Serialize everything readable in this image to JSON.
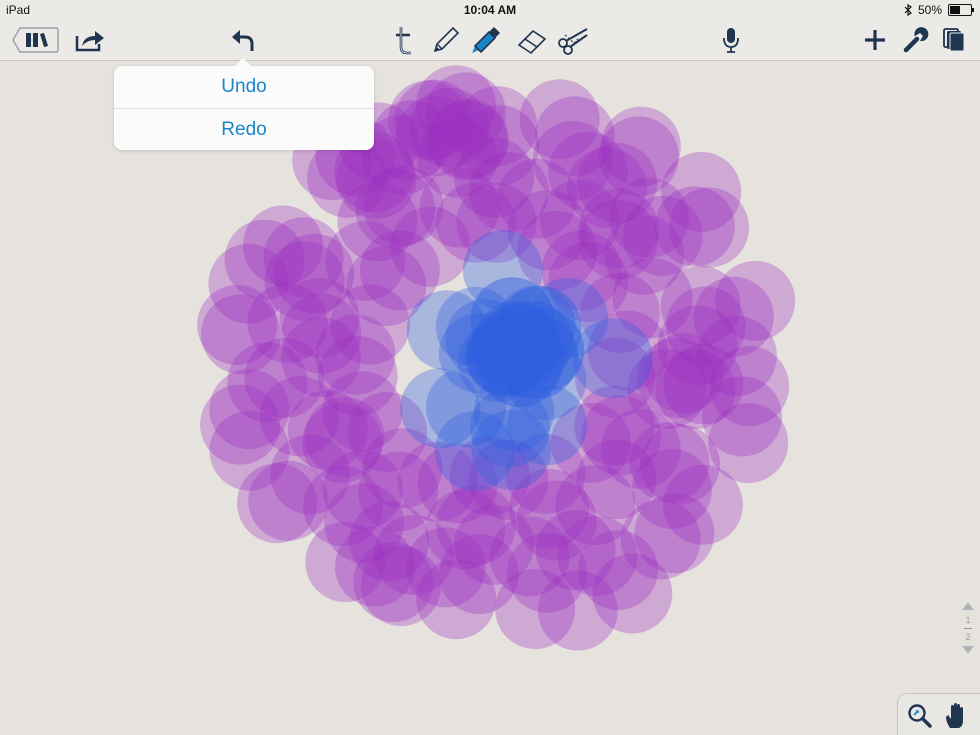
{
  "status_bar": {
    "device": "iPad",
    "time": "10:04 AM",
    "battery_text": "50%",
    "battery_level": 0.5
  },
  "toolbar": {
    "left": [
      {
        "name": "library-button",
        "icon": "library-icon"
      },
      {
        "name": "share-button",
        "icon": "share-icon"
      },
      {
        "name": "undo-button",
        "icon": "undo-arrow-icon"
      }
    ],
    "center": [
      {
        "name": "text-tool-button",
        "icon": "text-tool-icon"
      },
      {
        "name": "pencil-tool-button",
        "icon": "pencil-icon"
      },
      {
        "name": "highlighter-tool-button",
        "icon": "highlighter-icon",
        "selected": true
      },
      {
        "name": "eraser-tool-button",
        "icon": "eraser-icon"
      },
      {
        "name": "scissors-tool-button",
        "icon": "scissors-icon"
      }
    ],
    "right": [
      {
        "name": "microphone-button",
        "icon": "microphone-icon"
      },
      {
        "name": "add-button",
        "icon": "plus-icon"
      },
      {
        "name": "settings-button",
        "icon": "wrench-icon"
      },
      {
        "name": "pages-button",
        "icon": "pages-icon"
      }
    ]
  },
  "popover": {
    "items": [
      {
        "label": "Undo"
      },
      {
        "label": "Redo"
      }
    ]
  },
  "pager": {
    "current": "1",
    "total": "2"
  },
  "colors": {
    "toolbar_icon": "#1f3550",
    "accent_blue": "#1a86c8",
    "stroke_purple": "#9b2fc0",
    "stroke_blue": "#2f5fe0",
    "paper": "#e6e3de"
  },
  "bottom_panel": [
    {
      "name": "zoom-button",
      "icon": "zoom-icon"
    },
    {
      "name": "hand-tool-button",
      "icon": "hand-icon"
    }
  ]
}
